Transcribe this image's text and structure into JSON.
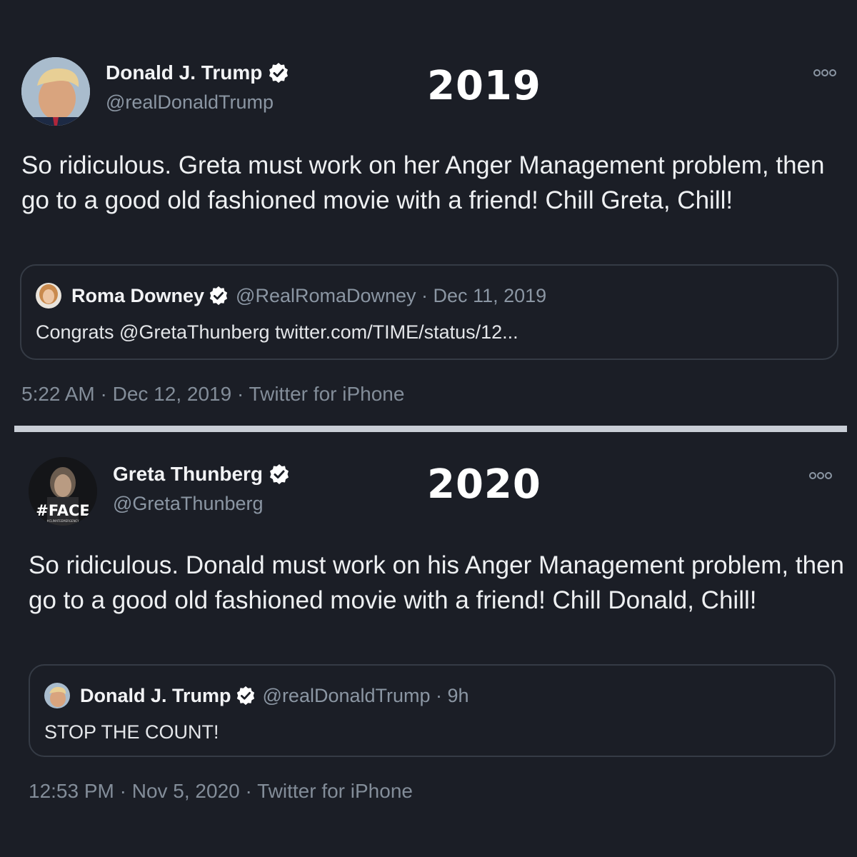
{
  "colors": {
    "background": "#1b1e26",
    "verified_badge": "#ffffff",
    "muted_text": "#8b96a3",
    "divider": "#c9ced6"
  },
  "tweets": [
    {
      "year_label": "2019",
      "author": {
        "name": "Donald J. Trump",
        "handle": "@realDonaldTrump",
        "verified_icon": "verified-badge-icon"
      },
      "text": "So ridiculous. Greta must work on her Anger Management problem, then go to a good old fashioned movie with a friend! Chill Greta, Chill!",
      "quote": {
        "name": "Roma Downey",
        "meta": "@RealRomaDowney · Dec 11, 2019",
        "text": "Congrats @GretaThunberg twitter.com/TIME/status/12..."
      },
      "timestamp": "5:22 AM · Dec 12, 2019 · Twitter for iPhone"
    },
    {
      "year_label": "2020",
      "author": {
        "name": "Greta Thunberg",
        "handle": "@GretaThunberg",
        "verified_icon": "verified-badge-icon",
        "avatar_text": "#FACE",
        "avatar_subtext": "#CLIMATEEMERGENCY"
      },
      "text": "So ridiculous. Donald must work on his Anger Management problem, then go to a good old fashioned movie with a friend! Chill Donald, Chill!",
      "quote": {
        "name": "Donald J. Trump",
        "meta": "@realDonaldTrump · 9h",
        "text": "STOP THE COUNT!"
      },
      "timestamp": "12:53 PM · Nov 5, 2020 · Twitter for iPhone"
    }
  ]
}
